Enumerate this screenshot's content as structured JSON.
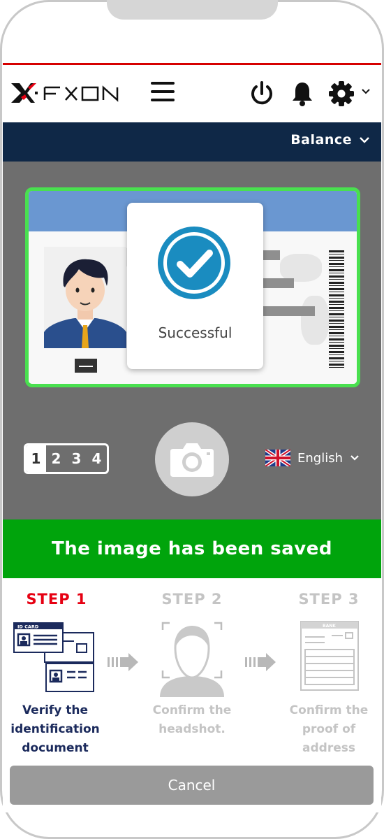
{
  "header": {
    "brand": "FXON",
    "menu_icon": "hamburger-icon",
    "power_icon": "power-icon",
    "bell_icon": "bell-icon",
    "settings_icon": "gear-icon"
  },
  "balance_bar": {
    "label": "Balance"
  },
  "capture": {
    "status_text": "Successful",
    "step_numbers": [
      "1",
      "2",
      "3",
      "4"
    ],
    "active_step_index": 0,
    "language": "English",
    "language_flag": "uk-flag-icon"
  },
  "banner": {
    "text": "The image has been saved"
  },
  "steps": [
    {
      "title": "STEP 1",
      "desc_lines": [
        "Verify the",
        "identification",
        "document"
      ],
      "state": "active"
    },
    {
      "title": "STEP 2",
      "desc_lines": [
        "Confirm the",
        "headshot."
      ],
      "state": "inactive"
    },
    {
      "title": "STEP 3",
      "desc_lines": [
        "Confirm the",
        "proof of",
        "address"
      ],
      "state": "inactive"
    }
  ],
  "step_icon_texts": {
    "id_card": "ID CARD",
    "bank": "BANK"
  },
  "cancel_label": "Cancel",
  "colors": {
    "accent_red": "#e60012",
    "nav_dark": "#0f2847",
    "success_green": "#00a40c",
    "check_blue": "#1a8cc0",
    "step_active_text": "#1b2a5c",
    "step_inactive_text": "#c4c4c4"
  }
}
